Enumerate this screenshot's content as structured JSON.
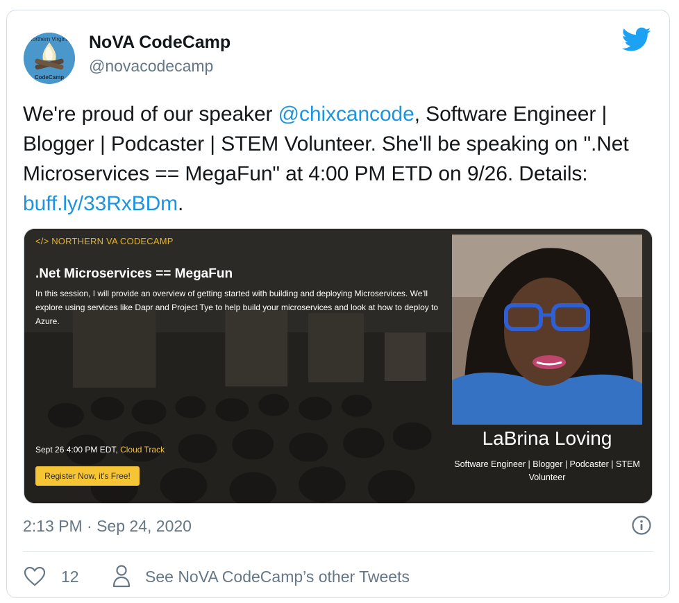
{
  "account": {
    "display_name": "NoVA CodeCamp",
    "handle": "@novacodecamp",
    "avatar_text_top": "Northern Virginia",
    "avatar_text_bottom": "CodeCamp"
  },
  "tweet": {
    "text_1": "We're proud of our speaker ",
    "mention": "@chixcancode",
    "text_2": ", Software Engineer | Blogger | Podcaster | STEM Volunteer. She'll be speaking on \".Net Microservices == MegaFun\" at 4:00 PM ETD on 9/26. Details: ",
    "link": "buff.ly/33RxBDm",
    "text_3": "."
  },
  "card": {
    "eyebrow": "</> NORTHERN VA CODECAMP",
    "title": ".Net Microservices == MegaFun",
    "description": "In this session, I will provide an overview of getting started with building and deploying Microservices. We'll explore using services like Dapr and Project Tye to help build your microservices and look at how to deploy to Azure.",
    "time": "Sept 26 4:00 PM EDT, ",
    "track": "Cloud Track",
    "register_label": "Register Now, it's Free!",
    "speaker_name": "LaBrina Loving",
    "speaker_role": "Software Engineer | Blogger | Podcaster | STEM Volunteer"
  },
  "meta": {
    "timestamp": "2:13 PM · Sep 24, 2020",
    "likes": "12",
    "other_tweets": "See NoVA CodeCamp’s other Tweets"
  },
  "colors": {
    "link": "#1b95e0",
    "accent_yellow": "#f6c535",
    "muted_text": "#657786"
  },
  "icons": [
    "twitter-bird-icon",
    "info-icon",
    "heart-icon",
    "person-icon"
  ]
}
